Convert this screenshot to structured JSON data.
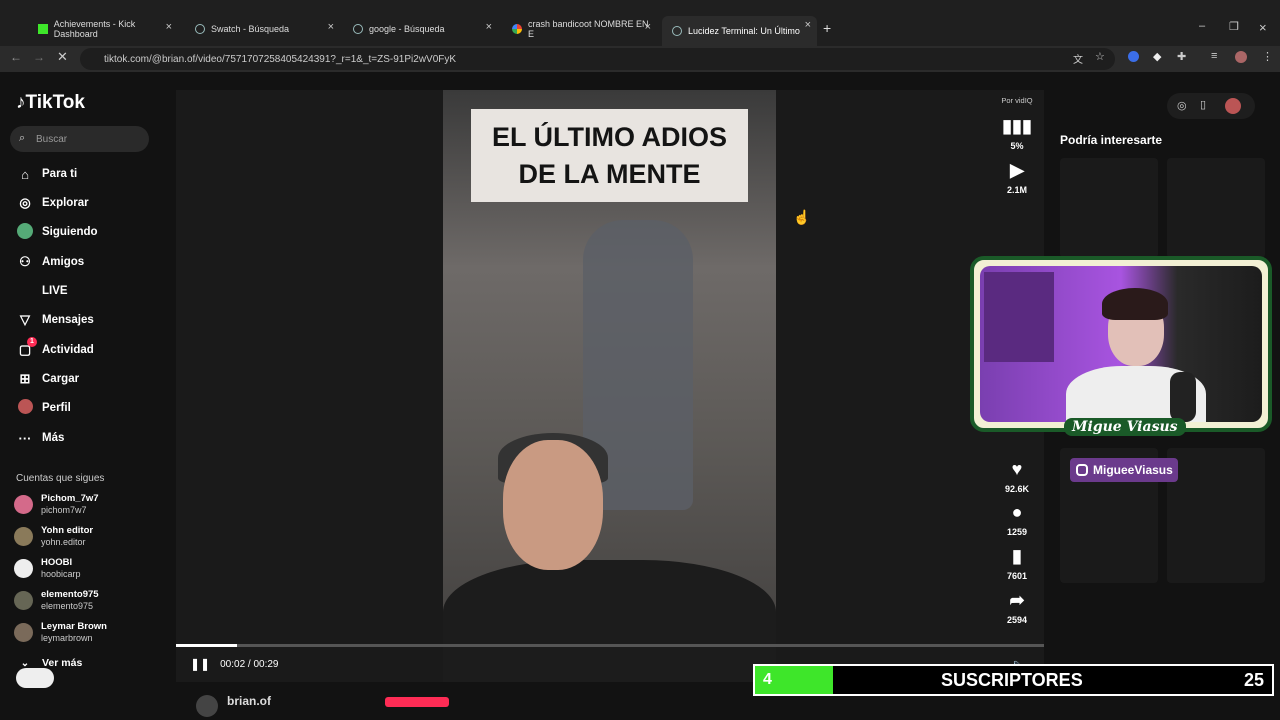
{
  "browser": {
    "tabs": [
      {
        "title": "Achievements - Kick Dashboard"
      },
      {
        "title": "Swatch - Búsqueda"
      },
      {
        "title": "google - Búsqueda"
      },
      {
        "title": "crash bandicoot NOMBRE EN E"
      },
      {
        "title": "Lucidez Terminal: Un Último"
      }
    ],
    "url": "tiktok.com/@brian.of/video/7571707258405424391?_r=1&_t=ZS-91Pi2wV0FyK"
  },
  "sidebar": {
    "logo": "TikTok",
    "search_placeholder": "Buscar",
    "nav": [
      {
        "label": "Para ti",
        "icon": "home-icon"
      },
      {
        "label": "Explorar",
        "icon": "compass-icon"
      },
      {
        "label": "Siguiendo",
        "icon": "avatar-icon"
      },
      {
        "label": "Amigos",
        "icon": "friends-icon"
      },
      {
        "label": "LIVE",
        "icon": "live-icon"
      },
      {
        "label": "Mensajes",
        "icon": "send-icon"
      },
      {
        "label": "Actividad",
        "icon": "inbox-icon",
        "badge": "1"
      },
      {
        "label": "Cargar",
        "icon": "plus-square-icon"
      },
      {
        "label": "Perfil",
        "icon": "profile-icon"
      },
      {
        "label": "Más",
        "icon": "more-icon"
      }
    ],
    "following_header": "Cuentas que sigues",
    "accounts": [
      {
        "name": "Pichom_7w7",
        "handle": "pichom7w7"
      },
      {
        "name": "Yohn editor",
        "handle": "yohn.editor"
      },
      {
        "name": "HOOBI",
        "handle": "hoobicarp"
      },
      {
        "name": "elemento975",
        "handle": "elemento975"
      },
      {
        "name": "Leymar Brown",
        "handle": "leymarbrown"
      }
    ],
    "see_more": "Ver más"
  },
  "video": {
    "caption_line1": "EL ÚLTIMO ADIOS",
    "caption_line2": "DE LA MENTE",
    "time": "00:02 / 00:29",
    "progress": 0.07,
    "author": "brian.of"
  },
  "rail": {
    "by": "Por vidIQ",
    "percent": "5%",
    "views": "2.1M",
    "likes": "92.6K",
    "comments": "1259",
    "saves": "7601",
    "shares": "2594"
  },
  "right": {
    "heading": "Podría interesarte"
  },
  "overlay": {
    "streamer_name": "Migue Viasus",
    "instagram": "MigueeViasus",
    "sub_count": "4",
    "sub_label": "SUSCRIPTORES",
    "sub_goal": "25"
  }
}
